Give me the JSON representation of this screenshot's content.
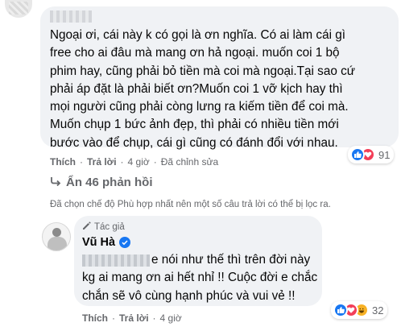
{
  "comment1": {
    "text": "Ngoại ơi, cái này k có gọi là ơn nghĩa. Có ai làm cái gì\nfree cho ai đâu mà mang ơn hả ngoại. muốn coi 1 bộ\nphim hay, cũng phải bỏ tiền mà coi mà ngoại.Tại sao cứ\nphải áp đặt là phải biết ơn?Muốn coi 1 vỡ kịch hay thì\nmọi người cũng phải còng lưng ra kiếm tiền để coi mà.\nMuốn chụp 1 bức ảnh đẹp, thì phải có nhiều tiền mới\nbước vào để chụp, cái gì cũng có đánh đổi với nhau.",
    "reaction_count": "91",
    "reactions": [
      "like-icon",
      "love-icon"
    ],
    "actions": {
      "like": "Thích",
      "reply": "Trả lời",
      "time": "4 giờ",
      "edited": "Đã chỉnh sửa"
    }
  },
  "thread": {
    "show_replies": "Ẩn 46 phản hồi",
    "notice": "Đã chọn chế độ Phù hợp nhất nên một số câu trả lời có thể bị lọc ra."
  },
  "comment2": {
    "author_tag": "Tác giả",
    "author_name": "Vũ Hà",
    "text": "e nói như thế thì trên đời này kg ai mang ơn ai hết nhỉ !! Cuộc đời e chắc chắn sẽ vô cùng hạnh phúc và vui vẻ !!",
    "reaction_count": "32",
    "reactions": [
      "like-icon",
      "love-icon",
      "haha-icon"
    ],
    "actions": {
      "like": "Thích",
      "reply": "Trả lời",
      "time": "4 giờ"
    }
  },
  "colors": {
    "bubble": "#f0f2f5",
    "secondary_text": "#65676b",
    "like_blue": "#1877f2",
    "love_red": "#f33e58",
    "haha_yellow": "#f7b125"
  }
}
